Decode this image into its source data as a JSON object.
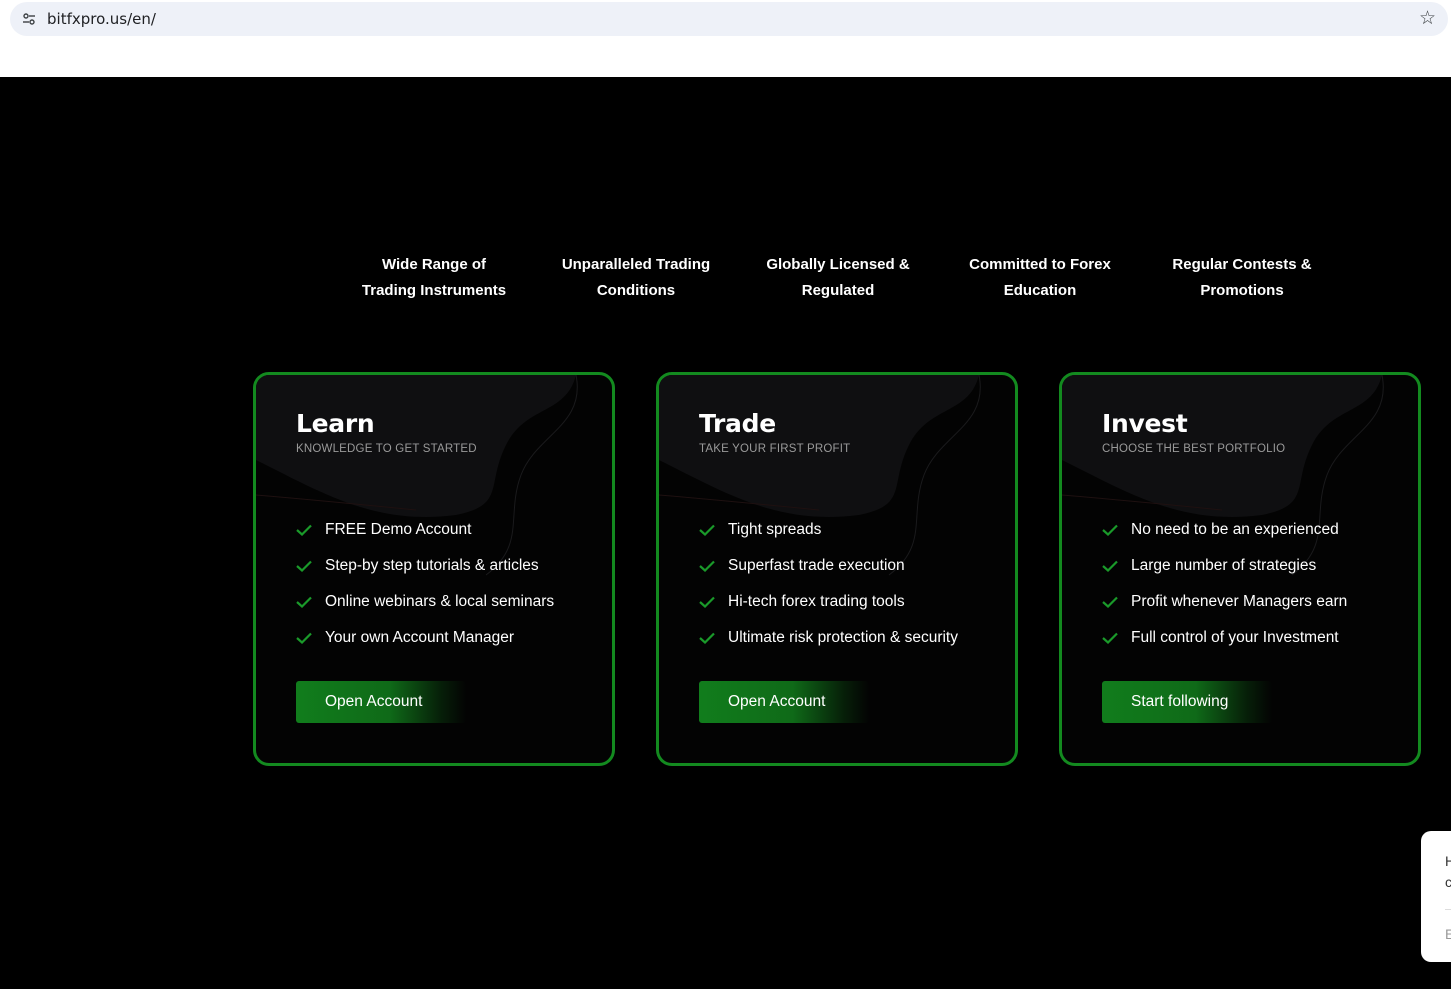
{
  "browser": {
    "url": "bitfxpro.us/en/",
    "site_settings_icon": "tune-icon",
    "bookmark_icon": "star-outline-icon"
  },
  "features": [
    {
      "line1": "Wide Range of",
      "line2": "Trading Instruments"
    },
    {
      "line1": "Unparalleled Trading",
      "line2": "Conditions"
    },
    {
      "line1": "Globally Licensed &",
      "line2": "Regulated"
    },
    {
      "line1": "Committed to Forex",
      "line2": "Education"
    },
    {
      "line1": "Regular Contests &",
      "line2": "Promotions"
    }
  ],
  "cards": [
    {
      "title": "Learn",
      "subtitle": "KNOWLEDGE TO GET STARTED",
      "items": [
        "FREE Demo Account",
        "Step-by step tutorials & articles",
        "Online webinars & local seminars",
        "Your own Account Manager"
      ],
      "button": "Open Account"
    },
    {
      "title": "Trade",
      "subtitle": "TAKE YOUR FIRST PROFIT",
      "items": [
        "Tight spreads",
        "Superfast trade execution",
        "Hi-tech forex trading tools",
        "Ultimate risk protection & security"
      ],
      "button": "Open Account"
    },
    {
      "title": "Invest",
      "subtitle": "CHOOSE THE BEST PORTFOLIO",
      "items": [
        "No need to be an experienced",
        "Large number of strategies",
        "Profit whenever Managers earn",
        "Full control of your Investment"
      ],
      "button": "Start following"
    }
  ],
  "chat_widget": {
    "line1": "H",
    "line2": "c",
    "line3": "E"
  },
  "colors": {
    "accent_green": "#138a1f",
    "check_green": "#1a9a2a",
    "background": "#000000"
  }
}
